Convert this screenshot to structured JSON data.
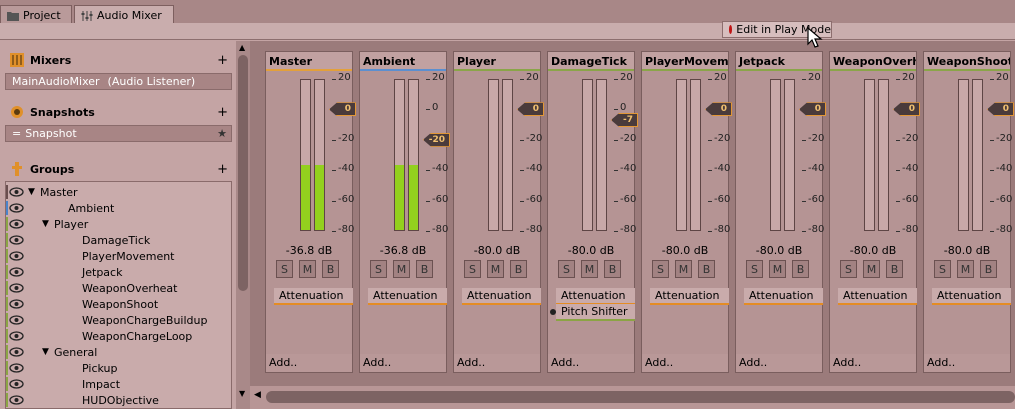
{
  "tabs": [
    {
      "label": "Project",
      "icon": "folder-icon"
    },
    {
      "label": "Audio Mixer",
      "icon": "mixer-icon"
    }
  ],
  "toolbar": {
    "play_mode_label": "Edit in Play Mode"
  },
  "sidebar": {
    "mixers": {
      "title": "Mixers",
      "add": "+",
      "items": [
        {
          "name": "MainAudioMixer",
          "suffix": "(Audio Listener)"
        }
      ]
    },
    "snapshots": {
      "title": "Snapshots",
      "add": "+",
      "items": [
        {
          "name": "Snapshot"
        }
      ]
    },
    "groups": {
      "title": "Groups",
      "add": "+",
      "items": [
        {
          "label": "Master",
          "expander": "▼"
        },
        {
          "label": "Ambient",
          "expander": ""
        },
        {
          "label": "Player",
          "expander": "▼"
        },
        {
          "label": "DamageTick",
          "expander": ""
        },
        {
          "label": "PlayerMovement",
          "expander": ""
        },
        {
          "label": "Jetpack",
          "expander": ""
        },
        {
          "label": "WeaponOverheat",
          "expander": ""
        },
        {
          "label": "WeaponShoot",
          "expander": ""
        },
        {
          "label": "WeaponChargeBuildup",
          "expander": ""
        },
        {
          "label": "WeaponChargeLoop",
          "expander": ""
        },
        {
          "label": "General",
          "expander": "▼"
        },
        {
          "label": "Pickup",
          "expander": ""
        },
        {
          "label": "Impact",
          "expander": ""
        },
        {
          "label": "HUDObjective",
          "expander": ""
        }
      ]
    }
  },
  "mixer": {
    "scale": [
      "20",
      "0",
      "-20",
      "-40",
      "-60",
      "-80"
    ],
    "smb": [
      "S",
      "M",
      "B"
    ],
    "strips": [
      {
        "name": "Master",
        "db": "-36.8 dB",
        "fader": "0",
        "fader_value": 0,
        "level": -36.8,
        "effects": [
          "Attenuation"
        ],
        "add": "Add..",
        "color": "#e3a03a"
      },
      {
        "name": "Ambient",
        "db": "-36.8 dB",
        "fader": "-20",
        "fader_value": -20,
        "level": -36.8,
        "effects": [
          "Attenuation"
        ],
        "add": "Add..",
        "color": "#5b8fd0"
      },
      {
        "name": "Player",
        "db": "-80.0 dB",
        "fader": "0",
        "fader_value": 0,
        "level": -80,
        "effects": [
          "Attenuation"
        ],
        "add": "Add..",
        "color": "#8aa548"
      },
      {
        "name": "DamageTick",
        "db": "-80.0 dB",
        "fader": "-7",
        "fader_value": -7,
        "level": -80,
        "effects": [
          "Attenuation",
          "Pitch Shifter"
        ],
        "add": "Add..",
        "color": "#8aa548"
      },
      {
        "name": "PlayerMovement",
        "db": "-80.0 dB",
        "fader": "0",
        "fader_value": 0,
        "level": -80,
        "effects": [
          "Attenuation"
        ],
        "add": "Add..",
        "color": "#8aa548"
      },
      {
        "name": "Jetpack",
        "db": "-80.0 dB",
        "fader": "0",
        "fader_value": 0,
        "level": -80,
        "effects": [
          "Attenuation"
        ],
        "add": "Add..",
        "color": "#8aa548"
      },
      {
        "name": "WeaponOverheat",
        "db": "-80.0 dB",
        "fader": "0",
        "fader_value": 0,
        "level": -80,
        "effects": [
          "Attenuation"
        ],
        "add": "Add..",
        "color": "#8aa548"
      },
      {
        "name": "WeaponShoot",
        "db": "-80.0 dB",
        "fader": "0",
        "fader_value": 0,
        "level": -80,
        "effects": [
          "Attenuation"
        ],
        "add": "Add..",
        "color": "#8aa548"
      }
    ]
  }
}
